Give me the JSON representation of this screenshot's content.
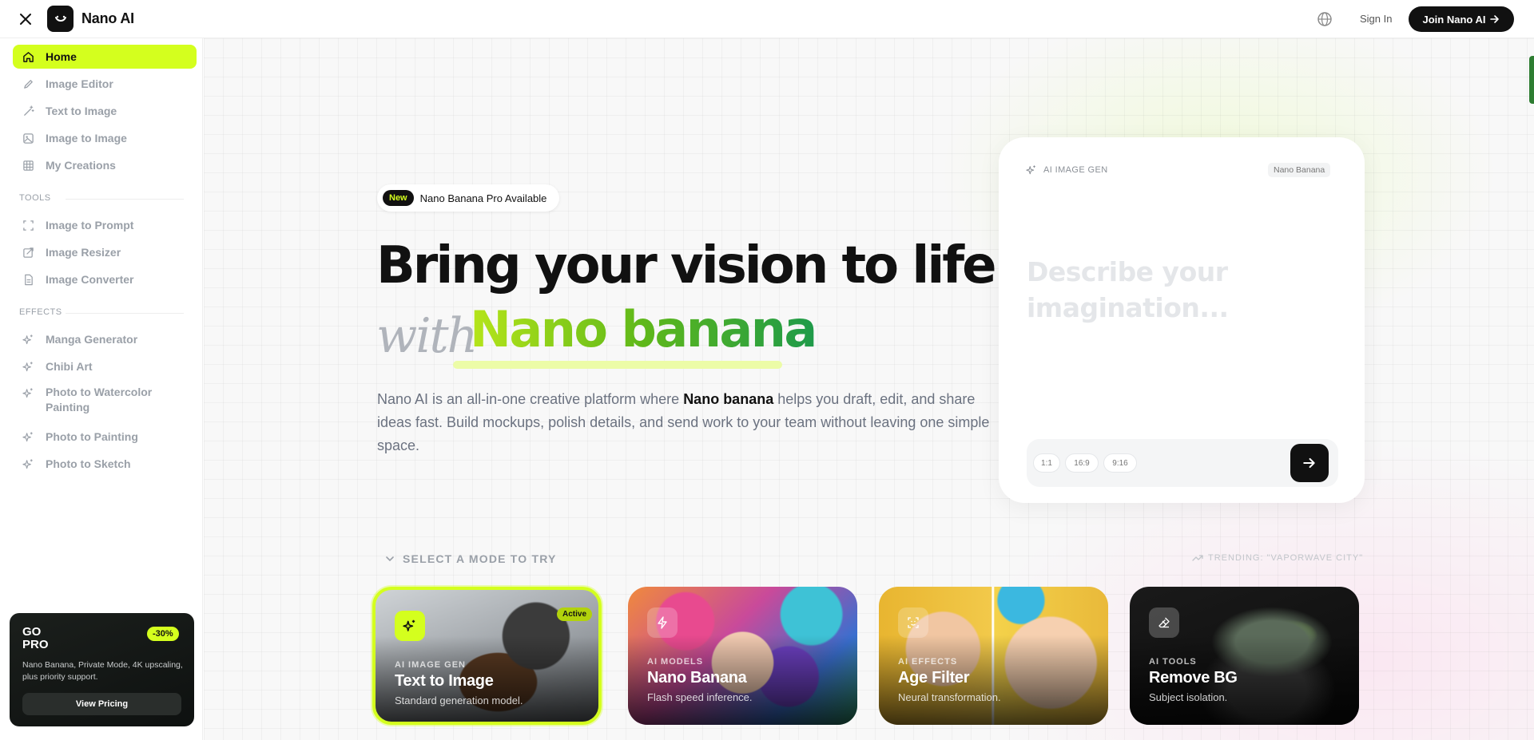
{
  "app": {
    "brand": "Nano AI"
  },
  "topbar": {
    "sign_in": "Sign In",
    "join": "Join Nano AI"
  },
  "sidebar": {
    "main_items": [
      {
        "label": "Home",
        "icon": "home-icon"
      },
      {
        "label": "Image Editor",
        "icon": "edit-icon"
      },
      {
        "label": "Text to Image",
        "icon": "wand-icon"
      },
      {
        "label": "Image to Image",
        "icon": "image-icon"
      },
      {
        "label": "My Creations",
        "icon": "grid-icon"
      }
    ],
    "tools_label": "TOOLS",
    "tools": [
      {
        "label": "Image to Prompt",
        "icon": "scan-icon"
      },
      {
        "label": "Image Resizer",
        "icon": "resize-icon"
      },
      {
        "label": "Image Converter",
        "icon": "file-icon"
      }
    ],
    "effects_label": "EFFECTS",
    "effects": [
      {
        "label": "Manga Generator",
        "icon": "sparkle-icon"
      },
      {
        "label": "Chibi Art",
        "icon": "sparkle-icon"
      },
      {
        "label": "Photo to Watercolor Painting",
        "icon": "sparkle-icon"
      },
      {
        "label": "Photo to Painting",
        "icon": "sparkle-icon"
      },
      {
        "label": "Photo to Sketch",
        "icon": "sparkle-icon"
      }
    ],
    "promo": {
      "title": "GO PRO",
      "badge": "-30%",
      "desc": "Nano Banana, Private Mode, 4K upscaling, plus priority support.",
      "button": "View Pricing"
    }
  },
  "hero": {
    "pill_new": "New",
    "pill_text": "Nano Banana Pro Available",
    "headline": "Bring your vision to life",
    "with": "with",
    "highlight": "Nano banana",
    "desc_before": "Nano AI is an all-in-one creative platform where ",
    "desc_bold": "Nano banana",
    "desc_after": " helps you draft, edit, and share ideas fast. Build mockups, polish details, and send work to your team without leaving one simple space."
  },
  "generator": {
    "header": "AI IMAGE GEN",
    "model_tag": "Nano Banana",
    "placeholder": "Describe your imagination...",
    "ratios": [
      "1:1",
      "16:9",
      "9:16"
    ]
  },
  "modes": {
    "label": "SELECT A MODE TO TRY",
    "trending": "TRENDING: \"VAPORWAVE CITY\"",
    "cards": [
      {
        "category": "AI IMAGE GEN",
        "title": "Text to Image",
        "subtitle": "Standard generation model.",
        "badge": "Active",
        "icon": "sparkle-icon"
      },
      {
        "category": "AI MODELS",
        "title": "Nano Banana",
        "subtitle": "Flash speed inference.",
        "icon": "bolt-icon"
      },
      {
        "category": "AI EFFECTS",
        "title": "Age Filter",
        "subtitle": "Neural transformation.",
        "icon": "face-scan-icon"
      },
      {
        "category": "AI TOOLS",
        "title": "Remove BG",
        "subtitle": "Subject isolation.",
        "icon": "eraser-icon"
      }
    ]
  },
  "colors": {
    "accent": "#d4ff1e",
    "dark": "#111111",
    "muted": "#9aa0a8"
  }
}
